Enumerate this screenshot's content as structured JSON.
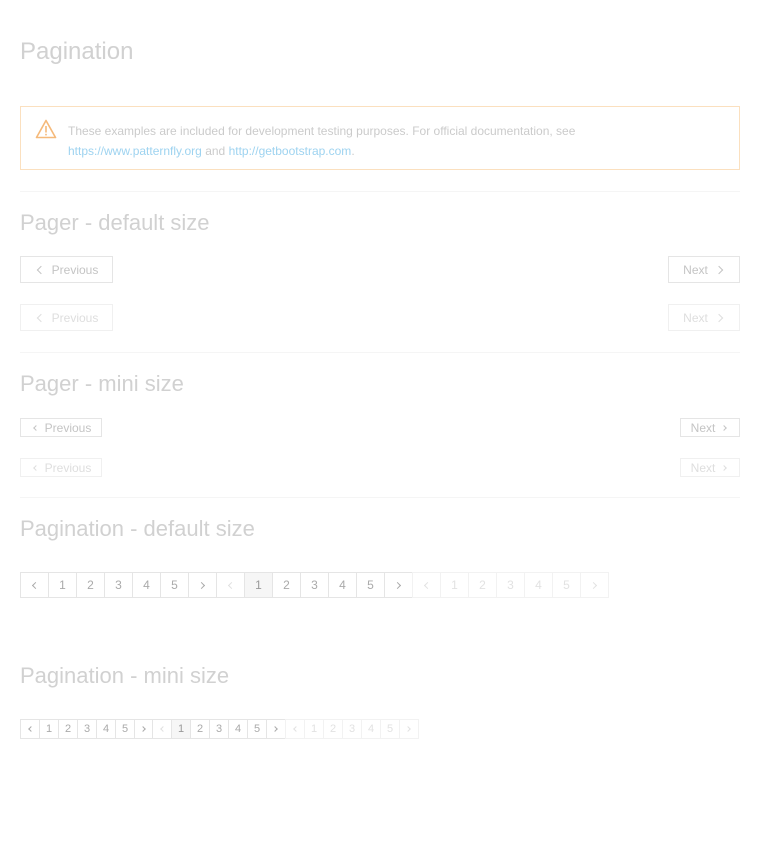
{
  "page_title": "Pagination",
  "alert": {
    "text": "These examples are included for development testing purposes. For official documentation, see",
    "link1": "https://www.patternfly.org",
    "and_text": "and",
    "link2": "http://getbootstrap.com",
    "period": "."
  },
  "sections": {
    "pager_default": "Pager - default size",
    "pager_mini": "Pager - mini size",
    "pagination_default": "Pagination - default size",
    "pagination_mini": "Pagination - mini size"
  },
  "pager": {
    "previous": "Previous",
    "next": "Next"
  },
  "pagination": {
    "pages": [
      "1",
      "2",
      "3",
      "4",
      "5"
    ]
  },
  "colors": {
    "warning_border": "#fbe0bf",
    "warning_icon": "#f5b97a",
    "link": "#9ed3f0"
  },
  "icons": {
    "warning": "warning-triangle-icon",
    "prev": "angle-left-icon",
    "next": "angle-right-icon"
  }
}
